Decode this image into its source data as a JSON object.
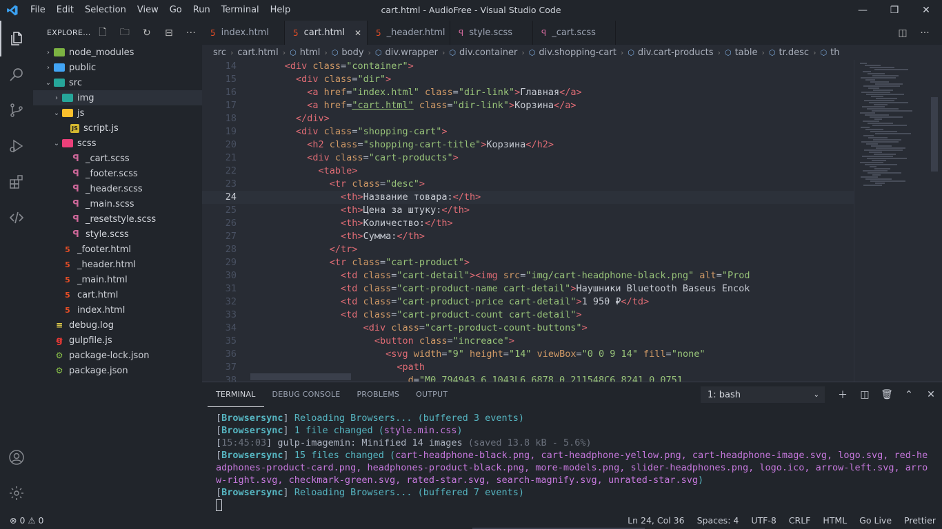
{
  "titlebar": {
    "menu": [
      "File",
      "Edit",
      "Selection",
      "View",
      "Go",
      "Run",
      "Terminal",
      "Help"
    ],
    "title": "cart.html - AudioFree - Visual Studio Code"
  },
  "explorer": {
    "title": "EXPLORE...",
    "tree": [
      {
        "label": "node_modules",
        "kind": "folder",
        "color": "green",
        "depth": 0,
        "chev": "›"
      },
      {
        "label": "public",
        "kind": "folder",
        "color": "blue",
        "depth": 0,
        "chev": "›"
      },
      {
        "label": "src",
        "kind": "folder",
        "color": "teal",
        "depth": 0,
        "chev": "⌄"
      },
      {
        "label": "img",
        "kind": "folder",
        "color": "teal",
        "depth": 1,
        "chev": "›",
        "sel": true
      },
      {
        "label": "js",
        "kind": "folder",
        "color": "yellow",
        "depth": 1,
        "chev": "⌄"
      },
      {
        "label": "script.js",
        "kind": "js",
        "depth": 2
      },
      {
        "label": "scss",
        "kind": "folder",
        "color": "pink",
        "depth": 1,
        "chev": "⌄"
      },
      {
        "label": "_cart.scss",
        "kind": "scss",
        "depth": 2
      },
      {
        "label": "_footer.scss",
        "kind": "scss",
        "depth": 2
      },
      {
        "label": "_header.scss",
        "kind": "scss",
        "depth": 2
      },
      {
        "label": "_main.scss",
        "kind": "scss",
        "depth": 2
      },
      {
        "label": "_resetstyle.scss",
        "kind": "scss",
        "depth": 2
      },
      {
        "label": "style.scss",
        "kind": "scss",
        "depth": 2
      },
      {
        "label": "_footer.html",
        "kind": "html",
        "depth": 1
      },
      {
        "label": "_header.html",
        "kind": "html",
        "depth": 1
      },
      {
        "label": "_main.html",
        "kind": "html",
        "depth": 1
      },
      {
        "label": "cart.html",
        "kind": "html",
        "depth": 1
      },
      {
        "label": "index.html",
        "kind": "html",
        "depth": 1
      },
      {
        "label": "debug.log",
        "kind": "log",
        "depth": 0
      },
      {
        "label": "gulpfile.js",
        "kind": "gulp",
        "depth": 0
      },
      {
        "label": "package-lock.json",
        "kind": "json",
        "depth": 0
      },
      {
        "label": "package.json",
        "kind": "json",
        "depth": 0
      }
    ]
  },
  "tabs": [
    {
      "label": "index.html",
      "type": "h"
    },
    {
      "label": "cart.html",
      "type": "h",
      "active": true
    },
    {
      "label": "_header.html",
      "type": "h"
    },
    {
      "label": "style.scss",
      "type": "s"
    },
    {
      "label": "_cart.scss",
      "type": "s"
    }
  ],
  "breadcrumb": [
    "src",
    "cart.html",
    "html",
    "body",
    "div.wrapper",
    "div.container",
    "div.shopping-cart",
    "div.cart-products",
    "table",
    "tr.desc",
    "th"
  ],
  "editor": {
    "current_line": 24,
    "lines": [
      {
        "n": "14",
        "i": 6,
        "seg": [
          [
            "tg",
            "<div "
          ],
          [
            "at",
            "class"
          ],
          [
            "pl",
            "="
          ],
          [
            "st",
            "\"container\""
          ],
          [
            "tg",
            ">"
          ]
        ]
      },
      {
        "n": "15",
        "i": 8,
        "seg": [
          [
            "tg",
            "<div "
          ],
          [
            "at",
            "class"
          ],
          [
            "pl",
            "="
          ],
          [
            "st",
            "\"dir\""
          ],
          [
            "tg",
            ">"
          ]
        ]
      },
      {
        "n": "16",
        "i": 10,
        "seg": [
          [
            "tg",
            "<a "
          ],
          [
            "at",
            "href"
          ],
          [
            "pl",
            "="
          ],
          [
            "st",
            "\"index.html\""
          ],
          [
            "at",
            " class"
          ],
          [
            "pl",
            "="
          ],
          [
            "st",
            "\"dir-link\""
          ],
          [
            "tg",
            ">"
          ],
          [
            "tx",
            "Главная"
          ],
          [
            "tg",
            "</a>"
          ]
        ]
      },
      {
        "n": "17",
        "i": 10,
        "seg": [
          [
            "tg",
            "<a "
          ],
          [
            "at",
            "href"
          ],
          [
            "pl",
            "="
          ],
          [
            "sq",
            "\"cart.html\""
          ],
          [
            "at",
            " class"
          ],
          [
            "pl",
            "="
          ],
          [
            "st",
            "\"dir-link\""
          ],
          [
            "tg",
            ">"
          ],
          [
            "tx",
            "Корзина"
          ],
          [
            "tg",
            "</a>"
          ]
        ]
      },
      {
        "n": "18",
        "i": 8,
        "seg": [
          [
            "tg",
            "</div>"
          ]
        ]
      },
      {
        "n": "19",
        "i": 8,
        "seg": [
          [
            "tg",
            "<div "
          ],
          [
            "at",
            "class"
          ],
          [
            "pl",
            "="
          ],
          [
            "st",
            "\"shopping-cart\""
          ],
          [
            "tg",
            ">"
          ]
        ]
      },
      {
        "n": "20",
        "i": 10,
        "seg": [
          [
            "tg",
            "<h2 "
          ],
          [
            "at",
            "class"
          ],
          [
            "pl",
            "="
          ],
          [
            "st",
            "\"shopping-cart-title\""
          ],
          [
            "tg",
            ">"
          ],
          [
            "tx",
            "Корзина"
          ],
          [
            "tg",
            "</h2>"
          ]
        ]
      },
      {
        "n": "21",
        "i": 10,
        "seg": [
          [
            "tg",
            "<div "
          ],
          [
            "at",
            "class"
          ],
          [
            "pl",
            "="
          ],
          [
            "st",
            "\"cart-products\""
          ],
          [
            "tg",
            ">"
          ]
        ]
      },
      {
        "n": "22",
        "i": 12,
        "seg": [
          [
            "tg",
            "<table>"
          ]
        ]
      },
      {
        "n": "23",
        "i": 14,
        "seg": [
          [
            "tg",
            "<tr "
          ],
          [
            "at",
            "class"
          ],
          [
            "pl",
            "="
          ],
          [
            "st",
            "\"desc\""
          ],
          [
            "tg",
            ">"
          ]
        ]
      },
      {
        "n": "24",
        "i": 16,
        "seg": [
          [
            "tg",
            "<th>"
          ],
          [
            "tx",
            "Название товара:"
          ],
          [
            "tg",
            "</th>"
          ]
        ]
      },
      {
        "n": "25",
        "i": 16,
        "seg": [
          [
            "tg",
            "<th>"
          ],
          [
            "tx",
            "Цена за штуку:"
          ],
          [
            "tg",
            "</th>"
          ]
        ]
      },
      {
        "n": "26",
        "i": 16,
        "seg": [
          [
            "tg",
            "<th>"
          ],
          [
            "tx",
            "Количество:"
          ],
          [
            "tg",
            "</th>"
          ]
        ]
      },
      {
        "n": "27",
        "i": 16,
        "seg": [
          [
            "tg",
            "<th>"
          ],
          [
            "tx",
            "Сумма:"
          ],
          [
            "tg",
            "</th>"
          ]
        ]
      },
      {
        "n": "28",
        "i": 14,
        "seg": [
          [
            "tg",
            "</tr>"
          ]
        ]
      },
      {
        "n": "29",
        "i": 14,
        "seg": [
          [
            "tg",
            "<tr "
          ],
          [
            "at",
            "class"
          ],
          [
            "pl",
            "="
          ],
          [
            "st",
            "\"cart-product\""
          ],
          [
            "tg",
            ">"
          ]
        ]
      },
      {
        "n": "30",
        "i": 16,
        "seg": [
          [
            "tg",
            "<td "
          ],
          [
            "at",
            "class"
          ],
          [
            "pl",
            "="
          ],
          [
            "st",
            "\"cart-detail\""
          ],
          [
            "tg",
            "><img "
          ],
          [
            "at",
            "src"
          ],
          [
            "pl",
            "="
          ],
          [
            "st",
            "\"img/cart-headphone-black.png\""
          ],
          [
            "at",
            " alt"
          ],
          [
            "pl",
            "="
          ],
          [
            "st",
            "\"Prod"
          ]
        ]
      },
      {
        "n": "31",
        "i": 16,
        "seg": [
          [
            "tg",
            "<td "
          ],
          [
            "at",
            "class"
          ],
          [
            "pl",
            "="
          ],
          [
            "st",
            "\"cart-product-name cart-detail\""
          ],
          [
            "tg",
            ">"
          ],
          [
            "tx",
            "Наушники Bluetooth Baseus Encok"
          ]
        ]
      },
      {
        "n": "32",
        "i": 16,
        "seg": [
          [
            "tg",
            "<td "
          ],
          [
            "at",
            "class"
          ],
          [
            "pl",
            "="
          ],
          [
            "st",
            "\"cart-product-price cart-detail\""
          ],
          [
            "tg",
            ">"
          ],
          [
            "tx",
            "1 950 ₽"
          ],
          [
            "tg",
            "</td>"
          ]
        ]
      },
      {
        "n": "33",
        "i": 16,
        "seg": [
          [
            "tg",
            "<td "
          ],
          [
            "at",
            "class"
          ],
          [
            "pl",
            "="
          ],
          [
            "st",
            "\"cart-product-count cart-detail\""
          ],
          [
            "tg",
            ">"
          ]
        ]
      },
      {
        "n": "34",
        "i": 20,
        "seg": [
          [
            "tg",
            "<div "
          ],
          [
            "at",
            "class"
          ],
          [
            "pl",
            "="
          ],
          [
            "st",
            "\"cart-product-count-buttons\""
          ],
          [
            "tg",
            ">"
          ]
        ]
      },
      {
        "n": "35",
        "i": 22,
        "seg": [
          [
            "tg",
            "<button "
          ],
          [
            "at",
            "class"
          ],
          [
            "pl",
            "="
          ],
          [
            "st",
            "\"increace\""
          ],
          [
            "tg",
            ">"
          ]
        ]
      },
      {
        "n": "36",
        "i": 24,
        "seg": [
          [
            "tg",
            "<svg "
          ],
          [
            "at",
            "width"
          ],
          [
            "pl",
            "="
          ],
          [
            "st",
            "\"9\""
          ],
          [
            "at",
            " height"
          ],
          [
            "pl",
            "="
          ],
          [
            "st",
            "\"14\""
          ],
          [
            "at",
            " viewBox"
          ],
          [
            "pl",
            "="
          ],
          [
            "st",
            "\"0 0 9 14\""
          ],
          [
            "at",
            " fill"
          ],
          [
            "pl",
            "="
          ],
          [
            "st",
            "\"none\""
          ]
        ]
      },
      {
        "n": "37",
        "i": 26,
        "seg": [
          [
            "tg",
            "<path"
          ]
        ]
      },
      {
        "n": "38",
        "i": 28,
        "seg": [
          [
            "at",
            "d"
          ],
          [
            "pl",
            "="
          ],
          [
            "st",
            "\"M0.794943 6.1043L6.6878 0.211548C6.8241 0.0751"
          ]
        ]
      }
    ]
  },
  "panel": {
    "tabs": [
      "TERMINAL",
      "DEBUG CONSOLE",
      "PROBLEMS",
      "OUTPUT"
    ],
    "shell": "1: bash",
    "lines": [
      [
        [
          "pl",
          "["
        ],
        [
          "bs",
          "Browsersync"
        ],
        [
          "pl",
          "] "
        ],
        [
          "cy",
          "Reloading Browsers... (buffered 3 events)"
        ]
      ],
      [
        [
          "pl",
          "["
        ],
        [
          "bs",
          "Browsersync"
        ],
        [
          "pl",
          "] "
        ],
        [
          "cy",
          "1 file changed ("
        ],
        [
          "mg",
          "style.min.css"
        ],
        [
          "cy",
          ")"
        ]
      ],
      [
        [
          "pl",
          "["
        ],
        [
          "dm",
          "15:45:03"
        ],
        [
          "pl",
          "] gulp-imagemin: Minified 14 images "
        ],
        [
          "dm",
          "(saved 13.8 kB - 5.6%)"
        ]
      ],
      [
        [
          "pl",
          "["
        ],
        [
          "bs",
          "Browsersync"
        ],
        [
          "pl",
          "] "
        ],
        [
          "cy",
          "15 files changed ("
        ],
        [
          "mg",
          "cart-headphone-black.png, cart-headphone-yellow.png, cart-headphone-image.svg, logo.svg, red-headphones-product-card.png, headphones-product-black.png, more-models.png, slider-headphones.png, logo.ico, arrow-left.svg, arrow-right.svg, checkmark-green.svg, rated-star.svg, search-magnify.svg, unrated-star.svg"
        ],
        [
          "cy",
          ")"
        ]
      ],
      [
        [
          "pl",
          "["
        ],
        [
          "bs",
          "Browsersync"
        ],
        [
          "pl",
          "] "
        ],
        [
          "cy",
          "Reloading Browsers... (buffered 7 events)"
        ]
      ]
    ]
  },
  "status": {
    "problems": "⊗ 0 ⚠ 0",
    "items": [
      "Ln 24, Col 36",
      "Spaces: 4",
      "UTF-8",
      "CRLF",
      "HTML",
      "Go Live",
      "Prettier"
    ]
  }
}
